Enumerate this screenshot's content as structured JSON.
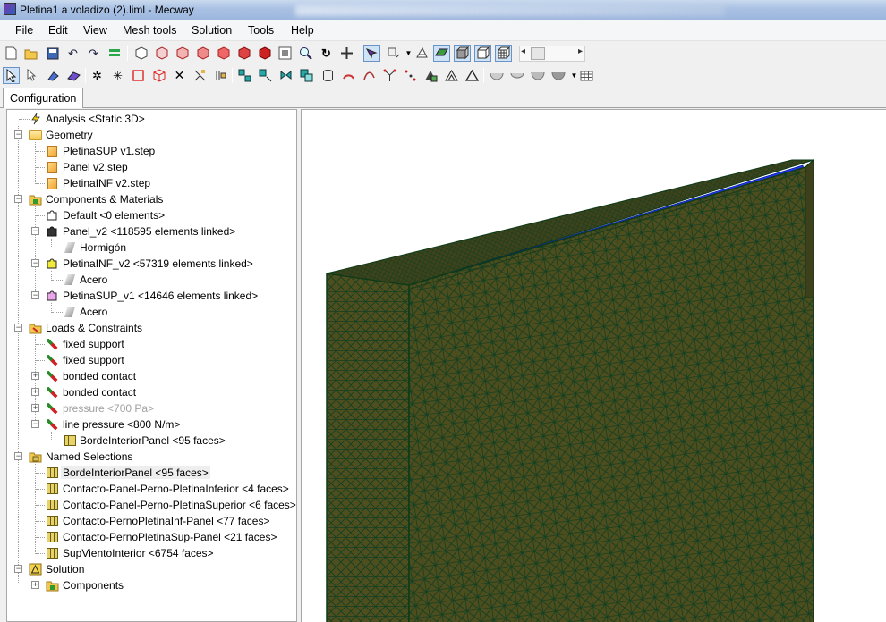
{
  "window": {
    "title": "Pletina1 a voladizo (2).liml - Mecway"
  },
  "menu": [
    "File",
    "Edit",
    "View",
    "Mesh tools",
    "Solution",
    "Tools",
    "Help"
  ],
  "tabs": {
    "active": "Configuration"
  },
  "tree": {
    "analysis": "Analysis <Static 3D>",
    "geometry": {
      "label": "Geometry",
      "items": [
        "PletinaSUP v1.step",
        "Panel v2.step",
        "PletinaINF v2.step"
      ]
    },
    "components": {
      "label": "Components & Materials",
      "default": "Default <0 elements>",
      "items": [
        {
          "label": "Panel_v2 <118595 elements linked>",
          "material": "Hormigón"
        },
        {
          "label": "PletinaINF_v2 <57319 elements linked>",
          "material": "Acero"
        },
        {
          "label": "PletinaSUP_v1 <14646 elements linked>",
          "material": "Acero"
        }
      ]
    },
    "loads": {
      "label": "Loads & Constraints",
      "items": [
        "fixed support",
        "fixed support",
        "bonded contact",
        "bonded contact",
        "pressure <700 Pa>",
        "line pressure <800 N/m>"
      ],
      "line_pressure_child": "BordeInteriorPanel <95 faces>"
    },
    "named_selections": {
      "label": "Named Selections",
      "items": [
        "BordeInteriorPanel <95 faces>",
        "Contacto-Panel-Perno-PletinaInferior <4 faces>",
        "Contacto-Panel-Perno-PletinaSuperior <6 faces>",
        "Contacto-PernoPletinaInf-Panel <77 faces>",
        "Contacto-PernoPletinaSup-Panel <21 faces>",
        "SupVientoInterior <6754 faces>"
      ]
    },
    "solution": {
      "label": "Solution",
      "child": "Components"
    }
  },
  "colors": {
    "mesh_fill": "#4a4a1c",
    "mesh_line": "#0e3a1a",
    "highlight_edge": "#1a2ee8",
    "selection_bg": "#eeeeee"
  }
}
